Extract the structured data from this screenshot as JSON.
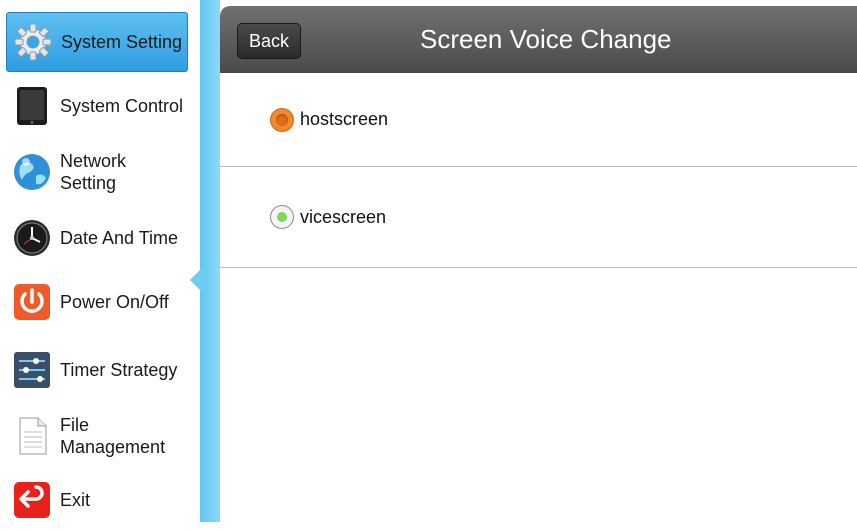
{
  "sidebar": {
    "items": [
      {
        "label": "System Setting",
        "icon": "gear-icon",
        "active": true
      },
      {
        "label": "System Control",
        "icon": "tablet-icon",
        "active": false
      },
      {
        "label": "Network Setting",
        "icon": "globe-icon",
        "active": false
      },
      {
        "label": "Date And Time",
        "icon": "clock-icon",
        "active": false
      },
      {
        "label": "Power On/Off",
        "icon": "power-icon",
        "active": false
      },
      {
        "label": "Timer Strategy",
        "icon": "sliders-icon",
        "active": false
      },
      {
        "label": "File Management",
        "icon": "document-icon",
        "active": false
      },
      {
        "label": "Exit",
        "icon": "exit-icon",
        "active": false
      }
    ]
  },
  "header": {
    "back_label": "Back",
    "title": "Screen Voice Change"
  },
  "options": [
    {
      "label": "hostscreen",
      "selected": true
    },
    {
      "label": "vicescreen",
      "selected": false
    }
  ],
  "colors": {
    "active_item": "#3aa6e6",
    "header": "#5a5a5a",
    "radio_selected": "#f28a2a",
    "radio_dot": "#7ed957"
  }
}
